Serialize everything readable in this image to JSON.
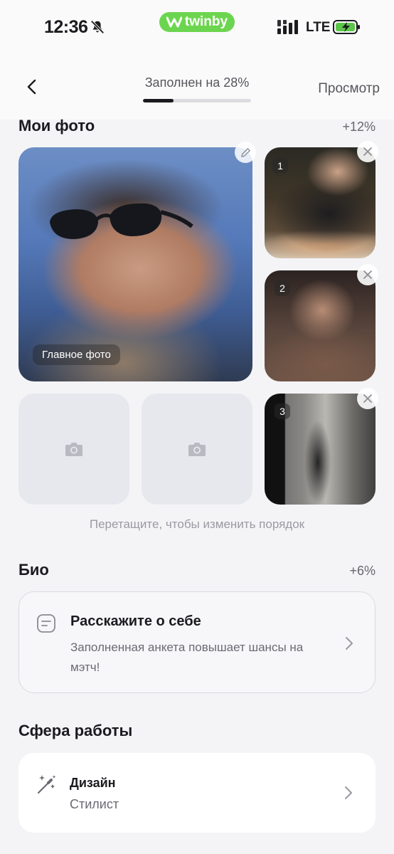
{
  "status_bar": {
    "time": "12:36",
    "network": "LTE",
    "brand": "twinby"
  },
  "header": {
    "progress_label": "Заполнен на 28%",
    "progress": 0.28,
    "preview_label": "Просмотр"
  },
  "photos": {
    "title": "Мои фото",
    "bonus": "+12%",
    "main_badge": "Главное фото",
    "thumbs": [
      {
        "number": "1"
      },
      {
        "number": "2"
      },
      {
        "number": "3"
      }
    ],
    "hint": "Перетащите, чтобы изменить порядок"
  },
  "bio": {
    "title": "Био",
    "bonus": "+6%",
    "card_title": "Расскажите о себе",
    "card_subtitle": "Заполненная анкета повышает шансы на мэтч!"
  },
  "work": {
    "title": "Сфера работы",
    "field": "Дизайн",
    "role": "Стилист"
  },
  "colors": {
    "brand": "#6cd54f",
    "accent_text": "#1b1b1f",
    "muted": "#66666d"
  }
}
